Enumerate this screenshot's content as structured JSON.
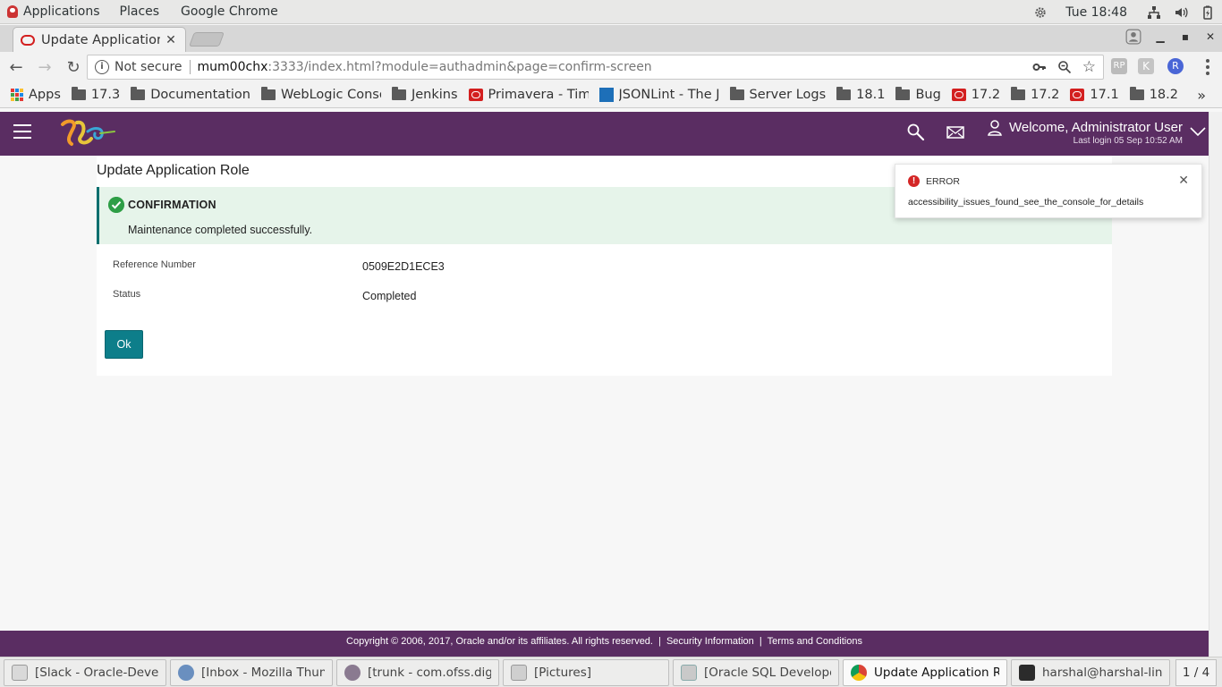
{
  "gnome": {
    "menus": [
      "Applications",
      "Places",
      "Google Chrome"
    ],
    "clock": "Tue 18:48"
  },
  "browser": {
    "tab_title": "Update Application Role",
    "security": "Not secure",
    "url_host": "mum00chx",
    "url_rest": ":3333/index.html?module=authadmin&page=confirm-screen",
    "ext_rp": "RP",
    "ext_k": "K",
    "ext_r": "R"
  },
  "bookmarks": {
    "apps": "Apps",
    "overflow": "»",
    "items": [
      {
        "label": "17.3",
        "icon": "folder-icon"
      },
      {
        "label": "Documentation",
        "icon": "folder-icon"
      },
      {
        "label": "WebLogic Conso",
        "icon": "folder-icon"
      },
      {
        "label": "Jenkins",
        "icon": "folder-icon"
      },
      {
        "label": "Primavera - Time",
        "icon": "oracle-icon"
      },
      {
        "label": "JSONLint - The J",
        "icon": "json-icon"
      },
      {
        "label": "Server Logs",
        "icon": "folder-icon"
      },
      {
        "label": "18.1",
        "icon": "folder-icon"
      },
      {
        "label": "Bug",
        "icon": "folder-icon"
      },
      {
        "label": "17.2",
        "icon": "oracle-icon"
      },
      {
        "label": "17.2",
        "icon": "folder-icon"
      },
      {
        "label": "17.1",
        "icon": "oracle-icon"
      },
      {
        "label": "18.2",
        "icon": "folder-icon"
      }
    ]
  },
  "app": {
    "welcome": "Welcome, Administrator User",
    "last_login": "Last login 05 Sep 10:52 AM",
    "page_title": "Update Application Role",
    "confirmation": {
      "heading": "CONFIRMATION",
      "message": "Maintenance completed successfully."
    },
    "fields": [
      {
        "label": "Reference Number",
        "value": "0509E2D1ECE3"
      },
      {
        "label": "Status",
        "value": "Completed"
      }
    ],
    "ok_label": "Ok",
    "toast": {
      "title": "ERROR",
      "message": "accessibility_issues_found_see_the_console_for_details"
    },
    "footer": {
      "copyright": "Copyright © 2006, 2017, Oracle and/or its affiliates. All rights reserved.",
      "security_link": "Security Information",
      "terms_link": "Terms and Conditions",
      "separator": "|"
    },
    "colors": {
      "header": "#5a2d62",
      "ok_button": "#0d7e8a",
      "confirm_bg": "#e6f4ea",
      "error": "#d42626"
    }
  },
  "taskbar": {
    "items": [
      {
        "label": "[Slack - Oracle-Develo...",
        "icon": "slack-icon"
      },
      {
        "label": "[Inbox - Mozilla Thund...",
        "icon": "thunderbird-icon"
      },
      {
        "label": "[trunk - com.ofss.digx....",
        "icon": "eclipse-icon"
      },
      {
        "label": "[Pictures]",
        "icon": "files-icon"
      },
      {
        "label": "[Oracle SQL Developer...",
        "icon": "sqldeveloper-icon"
      },
      {
        "label": "Update Application Rol...",
        "icon": "chrome-icon"
      },
      {
        "label": "harshal@harshal-linux:~",
        "icon": "terminal-icon"
      }
    ],
    "workspace": "1 / 4"
  }
}
